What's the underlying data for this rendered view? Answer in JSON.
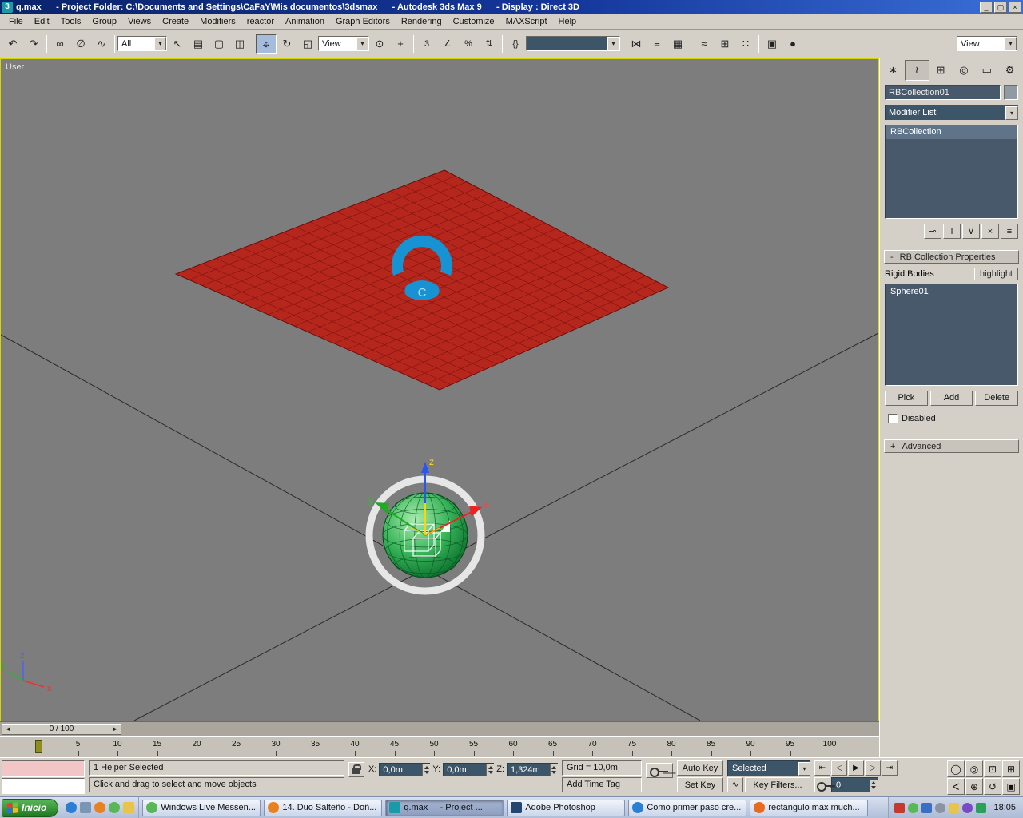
{
  "window": {
    "app_icon_glyph": "3",
    "title": "q.max      - Project Folder: C:\\Documents and Settings\\CaFaY\\Mis documentos\\3dsmax      - Autodesk 3ds Max 9      - Display : Direct 3D",
    "minimize_glyph": "_",
    "restore_glyph": "▢",
    "close_glyph": "×"
  },
  "menu": {
    "items": [
      "File",
      "Edit",
      "Tools",
      "Group",
      "Views",
      "Create",
      "Modifiers",
      "reactor",
      "Animation",
      "Graph Editors",
      "Rendering",
      "Customize",
      "MAXScript",
      "Help"
    ]
  },
  "toolbar": {
    "selection_filter": "All",
    "coord_system": "View",
    "named_sets": "",
    "view_preset": "View",
    "glyphs": {
      "undo": "↶",
      "redo": "↷",
      "link": "∞",
      "unlink": "∅",
      "bind": "∿",
      "select": "↖",
      "select_by_name": "▤",
      "region": "▢",
      "window_crossing": "◫",
      "move_h": "↔",
      "move_v": "↕",
      "rotate": "↻",
      "scale": "◱",
      "pivot": "⊙",
      "manipulate": "+",
      "snap": "3",
      "angle_snap": "∠",
      "percent_snap": "%",
      "spinner_snap": "⇅",
      "named_sets_edit": "{}",
      "mirror": "⋈",
      "align": "≡",
      "layers": "▦",
      "curve_editor": "≈",
      "schematic": "⊞",
      "material": "∷",
      "render_setup": "▣",
      "render": "●",
      "dropdown_arrow": "▾"
    }
  },
  "viewport": {
    "label": "User",
    "axis_x": "x",
    "axis_y": "y",
    "axis_z": "z"
  },
  "command_panel": {
    "tabs": {
      "create": "∗",
      "modify": "≀",
      "hierarchy": "⊞",
      "motion": "◎",
      "display": "▭",
      "utilities": "⚙"
    },
    "object_name": "RBCollection01",
    "modifier_list": "Modifier List",
    "stack_items": [
      "RBCollection"
    ],
    "stack_buttons": {
      "pin": "⊸",
      "show_end": "I",
      "unique": "∨",
      "remove": "×",
      "config": "≡"
    },
    "collapse_glyph": "-",
    "expand_glyph": "+",
    "rollout_properties": "RB Collection Properties",
    "rollout_advanced": "Advanced",
    "rigid_bodies_label": "Rigid Bodies",
    "highlight_button": "highlight",
    "rigid_bodies": [
      "Sphere01"
    ],
    "pick_button": "Pick",
    "add_button": "Add",
    "delete_button": "Delete",
    "disabled_label": "Disabled"
  },
  "timeline": {
    "slider_label": "0 / 100",
    "prev_glyph": "◄",
    "next_glyph": "►",
    "current_frame": 0,
    "range_start": 0,
    "range_end": 100,
    "ticks": [
      5,
      10,
      15,
      20,
      25,
      30,
      35,
      40,
      45,
      50,
      55,
      60,
      65,
      70,
      75,
      80,
      85,
      90,
      95,
      100
    ]
  },
  "status": {
    "selection": "1 Helper Selected",
    "prompt": "Click and drag to select and move objects",
    "x_label": "X:",
    "x_value": "0,0m",
    "y_label": "Y:",
    "y_value": "0,0m",
    "z_label": "Z:",
    "z_value": "1,324m",
    "grid": "Grid = 10,0m",
    "time_tag": "Add Time Tag",
    "auto_key": "Auto Key",
    "set_key": "Set Key",
    "key_mode": "Selected",
    "key_filters": "Key Filters...",
    "tangent_glyph": "∿",
    "frame": "0",
    "transport": {
      "start": "⇤",
      "prev": "◁",
      "play": "▶",
      "next": "▷",
      "end": "⇥"
    },
    "nav": {
      "zoom": "◯",
      "zoom_all": "◎",
      "zoom_extents": "⊡",
      "zoom_extents_all": "⊞",
      "fov": "∢",
      "pan": "⊕",
      "arc_rotate": "↺",
      "maximize": "▣"
    }
  },
  "taskbar": {
    "start": "Inicio",
    "tasks": [
      "Windows Live Messen...",
      "14. Duo Salteño - Doñ...",
      "q.max     - Project ...",
      "Adobe Photoshop",
      "Como primer paso cre...",
      "rectangulo max much..."
    ],
    "clock": "18:05"
  }
}
